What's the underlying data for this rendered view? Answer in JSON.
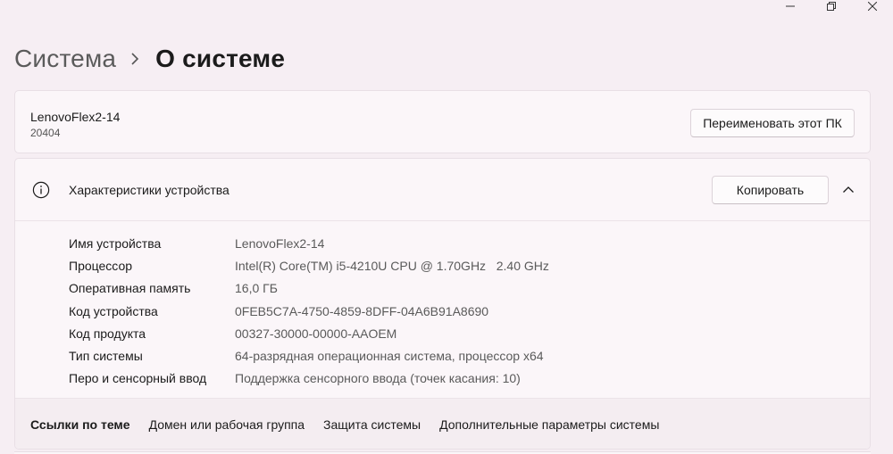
{
  "breadcrumb": {
    "parent": "Система",
    "current": "О системе"
  },
  "device": {
    "name": "LenovoFlex2-14",
    "sub": "20404",
    "rename_label": "Переименовать этот ПК"
  },
  "specs": {
    "title": "Характеристики устройства",
    "copy_label": "Копировать",
    "rows": [
      {
        "label": "Имя устройства",
        "value": "LenovoFlex2-14"
      },
      {
        "label": "Процессор",
        "value": "Intel(R) Core(TM) i5-4210U CPU @ 1.70GHz   2.40 GHz"
      },
      {
        "label": "Оперативная память",
        "value": "16,0 ГБ"
      },
      {
        "label": "Код устройства",
        "value": "0FEB5C7A-4750-4859-8DFF-04A6B91A8690"
      },
      {
        "label": "Код продукта",
        "value": "00327-30000-00000-AAOEM"
      },
      {
        "label": "Тип системы",
        "value": "64-разрядная операционная система, процессор x64"
      },
      {
        "label": "Перо и сенсорный ввод",
        "value": "Поддержка сенсорного ввода (точек касания: 10)"
      }
    ]
  },
  "related": {
    "title": "Ссылки по теме",
    "links": [
      "Домен или рабочая группа",
      "Защита системы",
      "Дополнительные параметры системы"
    ]
  },
  "icons": {
    "minimize": "minimize-icon",
    "restore": "restore-icon",
    "close": "close-icon",
    "breadcrumb_sep": "chevron-right-icon",
    "info": "info-icon",
    "collapse": "chevron-up-icon"
  }
}
